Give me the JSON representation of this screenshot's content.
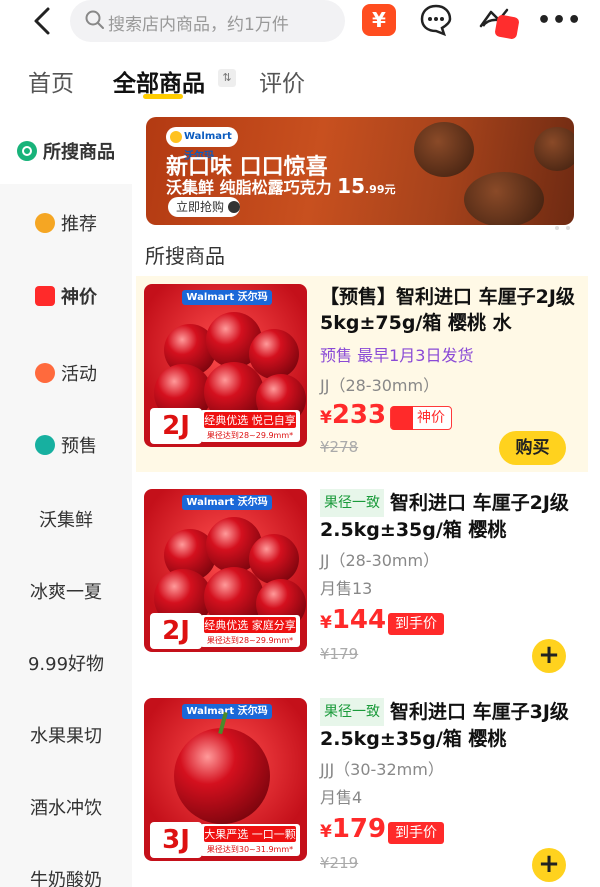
{
  "search": {
    "placeholder": "搜索店内商品，约1万件"
  },
  "header": {
    "yen_label": "¥"
  },
  "tabs": [
    {
      "label": "首页"
    },
    {
      "label": "全部商品"
    },
    {
      "label": "评价"
    }
  ],
  "sidebar": {
    "items": [
      {
        "label": "所搜商品"
      },
      {
        "label": "推荐"
      },
      {
        "label": "神价"
      },
      {
        "label": "活动"
      },
      {
        "label": "预售"
      },
      {
        "label": "沃集鲜"
      },
      {
        "label": "冰爽一夏"
      },
      {
        "label": "9.99好物"
      },
      {
        "label": "水果果切"
      },
      {
        "label": "酒水冲饮"
      },
      {
        "label": "牛奶酸奶"
      }
    ]
  },
  "banner": {
    "logo": "Walmart 沃尔玛",
    "title": "新口味 口口惊喜",
    "subtitle": "沃集鲜 纯脂松露巧克力",
    "price": "15",
    "price_dec": ".99元",
    "button": "立即抢购"
  },
  "section_title": "所搜商品",
  "products": [
    {
      "img_brand": "Walmart 沃尔玛",
      "img_grade": "2J",
      "img_tag1": "经典优选 悦己自享",
      "img_tag2": "果径达到28~29.9mm*",
      "title": "【预售】智利进口 车厘子2J级 5kg±75g/箱 樱桃 水",
      "presale": "预售   最早1月3日发货",
      "spec": "JJ（28-30mm）",
      "currency": "¥",
      "price": "233",
      "price_tag": "神价",
      "orig": "¥278",
      "buy": "购买"
    },
    {
      "img_brand": "Walmart 沃尔玛",
      "img_grade": "2J",
      "img_tag1": "经典优选 家庭分享",
      "img_tag2": "果径达到28~29.9mm*",
      "badge": "果径一致",
      "title": "智利进口 车厘子2J级 2.5kg±35g/箱 樱桃",
      "spec": "JJ（28-30mm）",
      "sold": "月售13",
      "currency": "¥",
      "price": "144",
      "price_tag": "到手价",
      "orig": "¥179",
      "add": "+"
    },
    {
      "img_brand": "Walmart 沃尔玛",
      "img_grade": "3J",
      "img_tag1": "大果严选 一口一颗",
      "img_tag2": "果径达到30~31.9mm*",
      "badge": "果径一致",
      "title": "智利进口 车厘子3J级 2.5kg±35g/箱 樱桃",
      "spec": "JJJ（30-32mm）",
      "sold": "月售4",
      "currency": "¥",
      "price": "179",
      "price_tag": "到手价",
      "orig": "¥219",
      "add": "+"
    }
  ]
}
